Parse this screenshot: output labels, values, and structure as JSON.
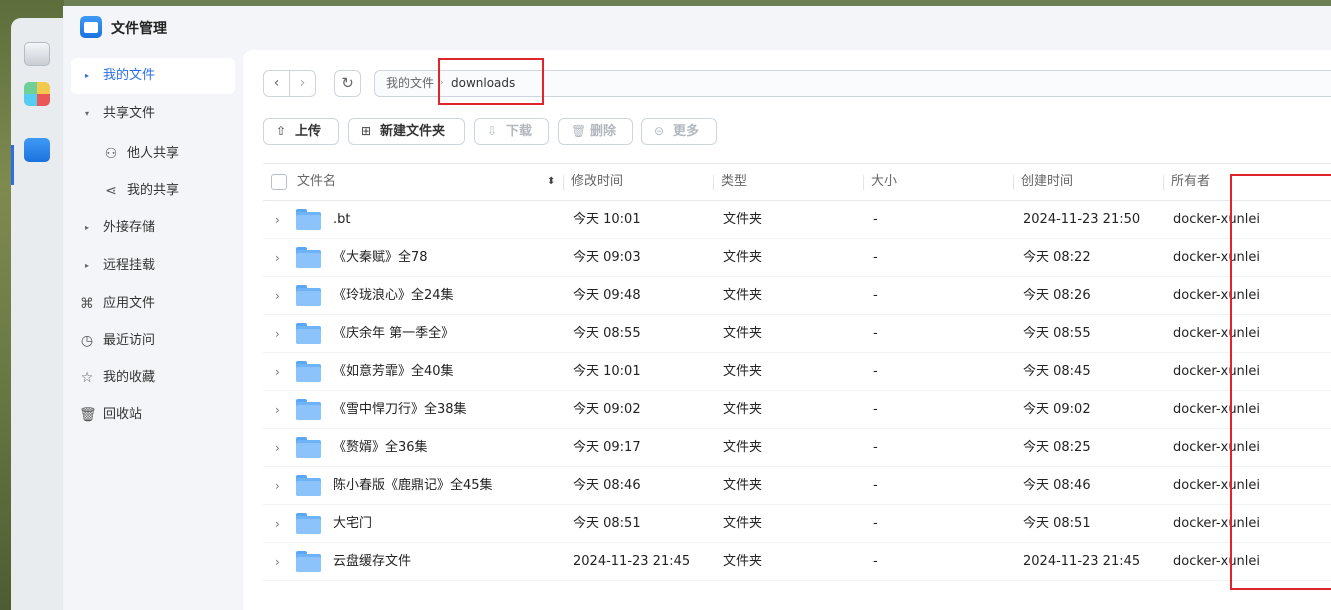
{
  "app": {
    "title": "文件管理"
  },
  "sidebar": {
    "items": [
      {
        "label": "我的文件",
        "icon": "caret-right-icon",
        "active": true
      },
      {
        "label": "共享文件",
        "icon": "caret-down-icon"
      },
      {
        "label": "他人共享",
        "icon": "users-icon"
      },
      {
        "label": "我的共享",
        "icon": "share-icon"
      },
      {
        "label": "外接存储",
        "icon": "caret-right-icon"
      },
      {
        "label": "远程挂载",
        "icon": "caret-right-icon"
      },
      {
        "label": "应用文件",
        "icon": "command-icon"
      },
      {
        "label": "最近访问",
        "icon": "clock-icon"
      },
      {
        "label": "我的收藏",
        "icon": "star-icon"
      },
      {
        "label": "回收站",
        "icon": "trash-icon"
      }
    ]
  },
  "path": {
    "root": "我的文件",
    "current": "downloads"
  },
  "toolbar": {
    "upload": "上传",
    "new_folder": "新建文件夹",
    "download": "下载",
    "delete": "删除",
    "more": "更多"
  },
  "table": {
    "columns": [
      "文件名",
      "修改时间",
      "类型",
      "大小",
      "创建时间",
      "所有者"
    ],
    "rows": [
      {
        "name": ".bt",
        "modified": "今天 10:01",
        "type": "文件夹",
        "size": "-",
        "created": "2024-11-23 21:50",
        "owner": "docker-xunlei"
      },
      {
        "name": "《大秦赋》全78",
        "modified": "今天 09:03",
        "type": "文件夹",
        "size": "-",
        "created": "今天 08:22",
        "owner": "docker-xunlei"
      },
      {
        "name": "《玲珑浪心》全24集",
        "modified": "今天 09:48",
        "type": "文件夹",
        "size": "-",
        "created": "今天 08:26",
        "owner": "docker-xunlei"
      },
      {
        "name": "《庆余年 第一季全》",
        "modified": "今天 08:55",
        "type": "文件夹",
        "size": "-",
        "created": "今天 08:55",
        "owner": "docker-xunlei"
      },
      {
        "name": "《如意芳霏》全40集",
        "modified": "今天 10:01",
        "type": "文件夹",
        "size": "-",
        "created": "今天 08:45",
        "owner": "docker-xunlei"
      },
      {
        "name": "《雪中悍刀行》全38集",
        "modified": "今天 09:02",
        "type": "文件夹",
        "size": "-",
        "created": "今天 09:02",
        "owner": "docker-xunlei"
      },
      {
        "name": "《赘婿》全36集",
        "modified": "今天 09:17",
        "type": "文件夹",
        "size": "-",
        "created": "今天 08:25",
        "owner": "docker-xunlei"
      },
      {
        "name": "陈小春版《鹿鼎记》全45集",
        "modified": "今天 08:46",
        "type": "文件夹",
        "size": "-",
        "created": "今天 08:46",
        "owner": "docker-xunlei"
      },
      {
        "name": "大宅门",
        "modified": "今天 08:51",
        "type": "文件夹",
        "size": "-",
        "created": "今天 08:51",
        "owner": "docker-xunlei"
      },
      {
        "name": "云盘缓存文件",
        "modified": "2024-11-23 21:45",
        "type": "文件夹",
        "size": "-",
        "created": "2024-11-23 21:45",
        "owner": "docker-xunlei"
      }
    ]
  },
  "colors": {
    "accent": "#2b6fe6",
    "highlight": "#e0242b",
    "folder": "#6eb3f8"
  }
}
